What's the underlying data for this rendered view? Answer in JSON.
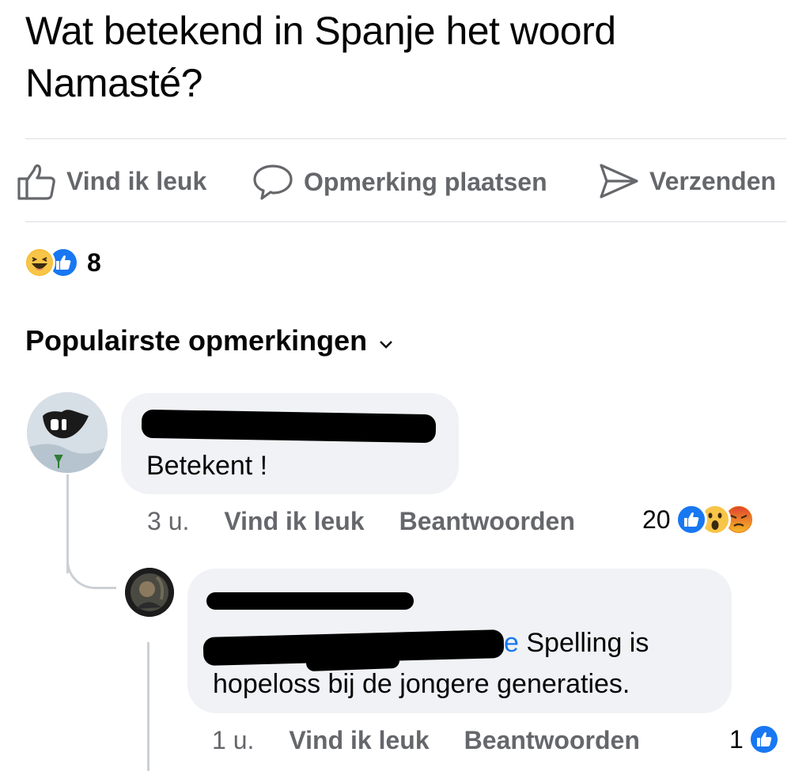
{
  "post": {
    "text": "Wat betekend in Spanje het woord Namasté?"
  },
  "actions": {
    "like": "Vind ik leuk",
    "comment": "Opmerking plaatsen",
    "share": "Verzenden"
  },
  "reactions": {
    "count": "8",
    "icons": [
      "haha-icon",
      "like-icon"
    ]
  },
  "comments_header": {
    "label": "Populairste opmerkingen",
    "icon": "chevron-down-icon"
  },
  "comments": [
    {
      "author": "[redacted]",
      "text": "Betekent !",
      "time": "3 u.",
      "like_label": "Vind ik leuk",
      "reply_label": "Beantwoorden",
      "reaction_count": "20",
      "reaction_icons": [
        "like-icon",
        "wow-icon",
        "angry-icon"
      ]
    },
    {
      "author": "[redacted]",
      "mention_tail": "e",
      "text": "Spelling is",
      "text_line2": "hopeloss bij de jongere generaties.",
      "time": "1 u.",
      "like_label": "Vind ik leuk",
      "reply_label": "Beantwoorden",
      "reaction_count": "1",
      "reaction_icons": [
        "like-icon"
      ]
    }
  ],
  "colors": {
    "accent": "#1877f2",
    "secondary_text": "#65676b",
    "bubble": "#f0f2f5",
    "divider": "#dadde1"
  }
}
